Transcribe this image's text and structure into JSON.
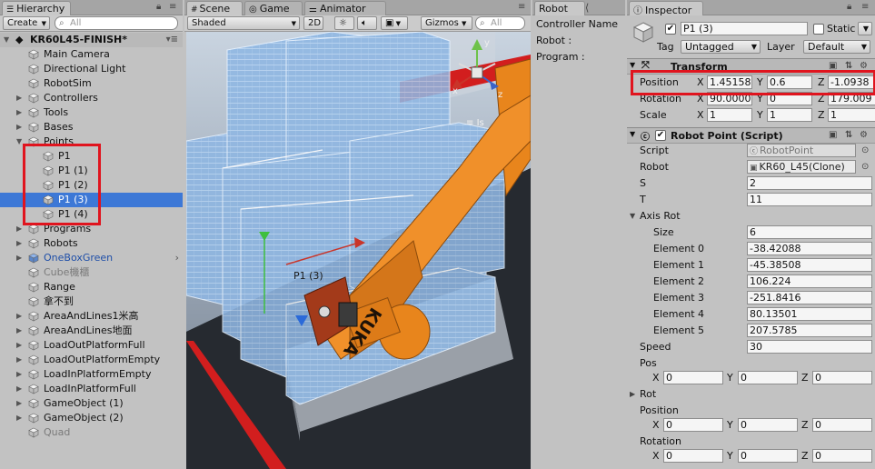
{
  "hierarchy": {
    "tab_label": "Hierarchy",
    "create_label": "Create",
    "search_placeholder": "All",
    "scene_name": "KR60L45-FINISH*",
    "items": [
      {
        "label": "Main Camera",
        "indent": 1,
        "foldout": false,
        "selected": false,
        "style": "normal"
      },
      {
        "label": "Directional Light",
        "indent": 1,
        "foldout": false,
        "selected": false,
        "style": "normal"
      },
      {
        "label": "RobotSim",
        "indent": 1,
        "foldout": false,
        "selected": false,
        "style": "normal"
      },
      {
        "label": "Controllers",
        "indent": 1,
        "foldout": "collapsed",
        "selected": false,
        "style": "normal"
      },
      {
        "label": "Tools",
        "indent": 1,
        "foldout": "collapsed",
        "selected": false,
        "style": "normal"
      },
      {
        "label": "Bases",
        "indent": 1,
        "foldout": "collapsed",
        "selected": false,
        "style": "normal"
      },
      {
        "label": "Points",
        "indent": 1,
        "foldout": "expanded",
        "selected": false,
        "style": "normal"
      },
      {
        "label": "P1",
        "indent": 2,
        "foldout": false,
        "selected": false,
        "style": "normal"
      },
      {
        "label": "P1 (1)",
        "indent": 2,
        "foldout": false,
        "selected": false,
        "style": "normal"
      },
      {
        "label": "P1 (2)",
        "indent": 2,
        "foldout": false,
        "selected": false,
        "style": "normal"
      },
      {
        "label": "P1 (3)",
        "indent": 2,
        "foldout": false,
        "selected": true,
        "style": "normal"
      },
      {
        "label": "P1 (4)",
        "indent": 2,
        "foldout": false,
        "selected": false,
        "style": "normal"
      },
      {
        "label": "Programs",
        "indent": 1,
        "foldout": "collapsed",
        "selected": false,
        "style": "normal"
      },
      {
        "label": "Robots",
        "indent": 1,
        "foldout": "collapsed",
        "selected": false,
        "style": "normal"
      },
      {
        "label": "OneBoxGreen",
        "indent": 1,
        "foldout": "collapsed",
        "selected": false,
        "style": "prefab"
      },
      {
        "label": "Cube機櫃",
        "indent": 1,
        "foldout": false,
        "selected": false,
        "style": "inactive"
      },
      {
        "label": "Range",
        "indent": 1,
        "foldout": false,
        "selected": false,
        "style": "normal"
      },
      {
        "label": "拿不到",
        "indent": 1,
        "foldout": false,
        "selected": false,
        "style": "normal"
      },
      {
        "label": "AreaAndLines1米高",
        "indent": 1,
        "foldout": "collapsed",
        "selected": false,
        "style": "normal"
      },
      {
        "label": "AreaAndLines地面",
        "indent": 1,
        "foldout": "collapsed",
        "selected": false,
        "style": "normal"
      },
      {
        "label": "LoadOutPlatformFull",
        "indent": 1,
        "foldout": "collapsed",
        "selected": false,
        "style": "normal"
      },
      {
        "label": "LoadOutPlatformEmpty",
        "indent": 1,
        "foldout": "collapsed",
        "selected": false,
        "style": "normal"
      },
      {
        "label": "LoadInPlatformEmpty",
        "indent": 1,
        "foldout": "collapsed",
        "selected": false,
        "style": "normal"
      },
      {
        "label": "LoadInPlatformFull",
        "indent": 1,
        "foldout": "collapsed",
        "selected": false,
        "style": "normal"
      },
      {
        "label": "GameObject (1)",
        "indent": 1,
        "foldout": "collapsed",
        "selected": false,
        "style": "normal"
      },
      {
        "label": "GameObject (2)",
        "indent": 1,
        "foldout": "collapsed",
        "selected": false,
        "style": "normal"
      },
      {
        "label": "Quad",
        "indent": 1,
        "foldout": false,
        "selected": false,
        "style": "inactive"
      }
    ]
  },
  "scene": {
    "tabs": [
      "Scene",
      "Game",
      "Animator"
    ],
    "shading_mode": "Shaded",
    "mode_2d": "2D",
    "gizmos_label": "Gizmos",
    "search_placeholder": "All",
    "point_label": "P1 (3)",
    "persp_label": "Is",
    "robot_brand_text": "KUKA",
    "gizmo_axes": {
      "x": "x",
      "y": "y",
      "z": "z"
    }
  },
  "robot_panel": {
    "tab_label": "Robot",
    "controller_name_label": "Controller Name",
    "robot_label": "Robot :",
    "program_label": "Program :"
  },
  "inspector": {
    "tab_label": "Inspector",
    "object_name": "P1 (3)",
    "static_label": "Static",
    "tag_label": "Tag",
    "tag_value": "Untagged",
    "layer_label": "Layer",
    "layer_value": "Default",
    "transform": {
      "title": "Transform",
      "position_label": "Position",
      "rotation_label": "Rotation",
      "scale_label": "Scale",
      "axis_labels": [
        "X",
        "Y",
        "Z"
      ],
      "position": [
        "1.45158",
        "0.6",
        "-1.0938"
      ],
      "rotation": [
        "90.0000",
        "0",
        "179.009"
      ],
      "scale": [
        "1",
        "1",
        "1"
      ]
    },
    "robot_point": {
      "title": "Robot Point (Script)",
      "script_label": "Script",
      "script_value": "RobotPoint",
      "robot_label": "Robot",
      "robot_value": "KR60_L45(Clone)",
      "s_label": "S",
      "s_value": "2",
      "t_label": "T",
      "t_value": "11",
      "axis_rot_label": "Axis Rot",
      "size_label": "Size",
      "size_value": "6",
      "elements": [
        {
          "label": "Element 0",
          "value": "-38.42088"
        },
        {
          "label": "Element 1",
          "value": "-45.38508"
        },
        {
          "label": "Element 2",
          "value": "106.224"
        },
        {
          "label": "Element 3",
          "value": "-251.8416"
        },
        {
          "label": "Element 4",
          "value": "80.13501"
        },
        {
          "label": "Element 5",
          "value": "207.5785"
        }
      ],
      "speed_label": "Speed",
      "speed_value": "30",
      "pos_label": "Pos",
      "pos": [
        "0",
        "0",
        "0"
      ],
      "rot_label": "Rot",
      "position_label": "Position",
      "position": [
        "0",
        "0",
        "0"
      ],
      "rotation_label": "Rotation",
      "rotation": [
        "0",
        "0",
        "0"
      ]
    }
  },
  "colors": {
    "selection": "#3d78d6",
    "highlight_box": "#e0141e",
    "robot_orange": "#e8851c",
    "prefab_text": "#1f4fa8"
  }
}
